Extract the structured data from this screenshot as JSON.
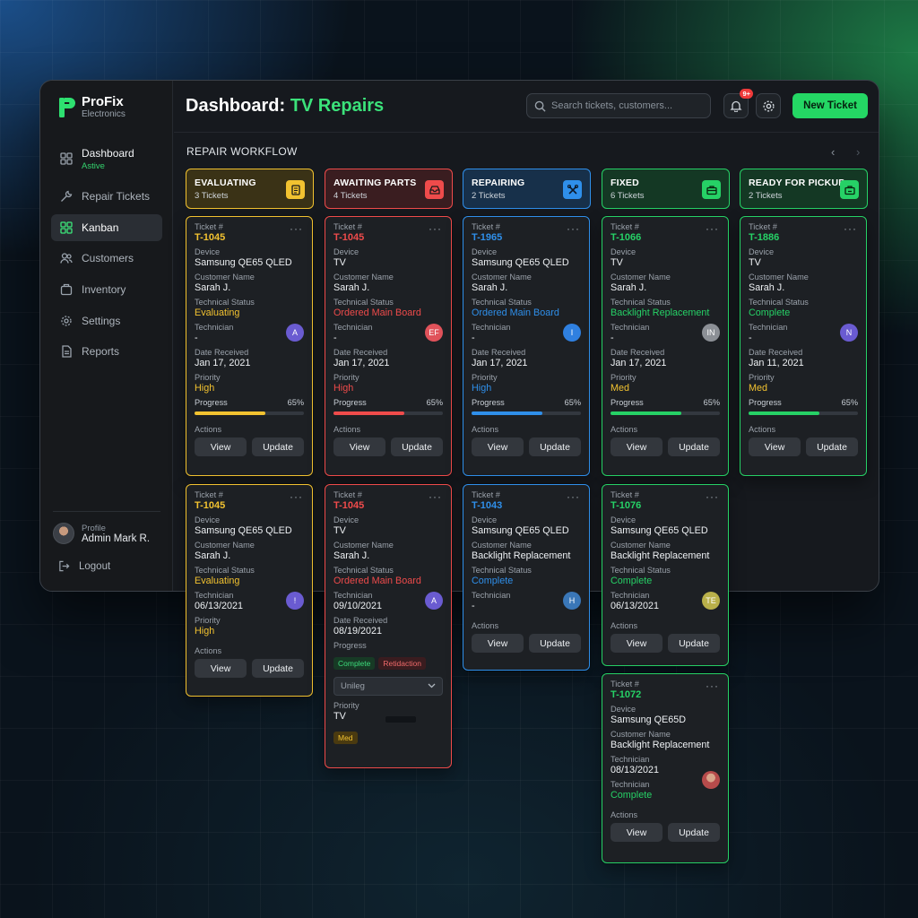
{
  "brand": {
    "name": "ProFix",
    "sub": "Electronics"
  },
  "nav": {
    "dashboard": {
      "label": "Dashboard",
      "sub": "Astive"
    },
    "repair_tickets": "Repair Tickets",
    "kanban": "Kanban",
    "customers": "Customers",
    "inventory": "Inventory",
    "settings": "Settings",
    "reports": "Reports"
  },
  "profile": {
    "label": "Profile",
    "name": "Admin Mark R.",
    "logout": "Logout"
  },
  "header": {
    "title_prefix": "Dashboard:",
    "title_accent": "TV Repairs",
    "search_placeholder": "Search tickets, customers...",
    "notif_badge": "9+",
    "new_ticket": "New Ticket"
  },
  "board": {
    "section_title": "REPAIR WORKFLOW",
    "prev": "‹",
    "next": "›"
  },
  "labels": {
    "ticket": "Ticket #",
    "device": "Device",
    "customer": "Customer Name",
    "tech_status": "Technical Status",
    "technician": "Technician",
    "date_received": "Date Received",
    "priority": "Priority",
    "progress": "Progress",
    "actions": "Actions",
    "view": "View",
    "update": "Update",
    "dots": "···"
  },
  "colors": {
    "evaluating": "#f2c230",
    "awaiting": "#ef4b4b",
    "repairing": "#2f8fea",
    "fixed": "#26d166",
    "ready": "#26d166"
  },
  "columns": [
    {
      "name": "EVALUATING",
      "count": "3 Tickets",
      "icon": "clipboard-icon",
      "cards": [
        {
          "ticket": "T-1045",
          "device": "Samsung QE65 QLED",
          "customer": "Sarah J.",
          "status": "Evaluating",
          "technician": "-",
          "tech_initials": "A",
          "date": "Jan 17, 2021",
          "priority": "High",
          "progress": "65%"
        },
        {
          "ticket": "T-1045",
          "device": "Samsung QE65 QLED",
          "customer": "Sarah J.",
          "status": "Evaluating",
          "technician": "06/13/2021",
          "tech_initials": "!",
          "priority": "High"
        }
      ]
    },
    {
      "name": "AWAITING PARTS",
      "count": "4 Tickets",
      "icon": "inbox-icon",
      "cards": [
        {
          "ticket": "T-1045",
          "device": "TV",
          "customer": "Sarah J.",
          "status": "Ordered Main Board",
          "technician": "-",
          "tech_initials": "EF",
          "date": "Jan 17, 2021",
          "priority": "High",
          "progress": "65%"
        },
        {
          "ticket": "T-1045",
          "device": "TV",
          "customer": "Sarah J.",
          "status": "Ordered Main Board",
          "technician": "09/10/2021",
          "tech_initials": "A",
          "date": "08/19/2021",
          "progress_label": "Progress",
          "chip1": "Complete",
          "chip2": "Retidaction",
          "select": "Unileg",
          "priority_value": "TV",
          "priority_chip": "Med"
        }
      ]
    },
    {
      "name": "REPAIRING",
      "count": "2 Tickets",
      "icon": "tools-icon",
      "cards": [
        {
          "ticket": "T-1965",
          "device": "Samsung QE65 QLED",
          "customer": "Sarah J.",
          "status": "Ordered Main Board",
          "technician": "-",
          "tech_initials": "I",
          "date": "Jan 17, 2021",
          "priority": "High",
          "progress": "65%"
        },
        {
          "ticket": "T-1043",
          "device": "Samsung QE65 QLED",
          "customer": "Backlight Replacement",
          "status": "Complete",
          "technician": "-",
          "tech_initials": "H"
        }
      ]
    },
    {
      "name": "FIXED",
      "count": "6 Tickets",
      "icon": "briefcase-icon",
      "cards": [
        {
          "ticket": "T-1066",
          "device": "TV",
          "customer": "Sarah J.",
          "status": "Backlight Replacement",
          "technician": "-",
          "tech_initials": "IN",
          "date": "Jan 17, 2021",
          "priority": "Med",
          "progress": "65%"
        },
        {
          "ticket": "T-1076",
          "device": "Samsung QE65 QLED",
          "customer": "Backlight Replacement",
          "status": "Complete",
          "technician": "06/13/2021",
          "tech_initials": "TE"
        },
        {
          "ticket": "T-1072",
          "device": "Samsung QE65D",
          "customer": "Backlight Replacement",
          "technician": "08/13/2021",
          "technician2_label": "Technician",
          "technician2": "Complete"
        }
      ]
    },
    {
      "name": "READY FOR PICKUP",
      "count": "2 Tickets",
      "icon": "bag-icon",
      "cards": [
        {
          "ticket": "T-1886",
          "device": "TV",
          "customer": "Sarah J.",
          "status": "Complete",
          "technician": "-",
          "tech_initials": "N",
          "date": "Jan 11, 2021",
          "priority": "Med",
          "progress": "65%"
        }
      ]
    }
  ],
  "progress_fraction": 0.65
}
